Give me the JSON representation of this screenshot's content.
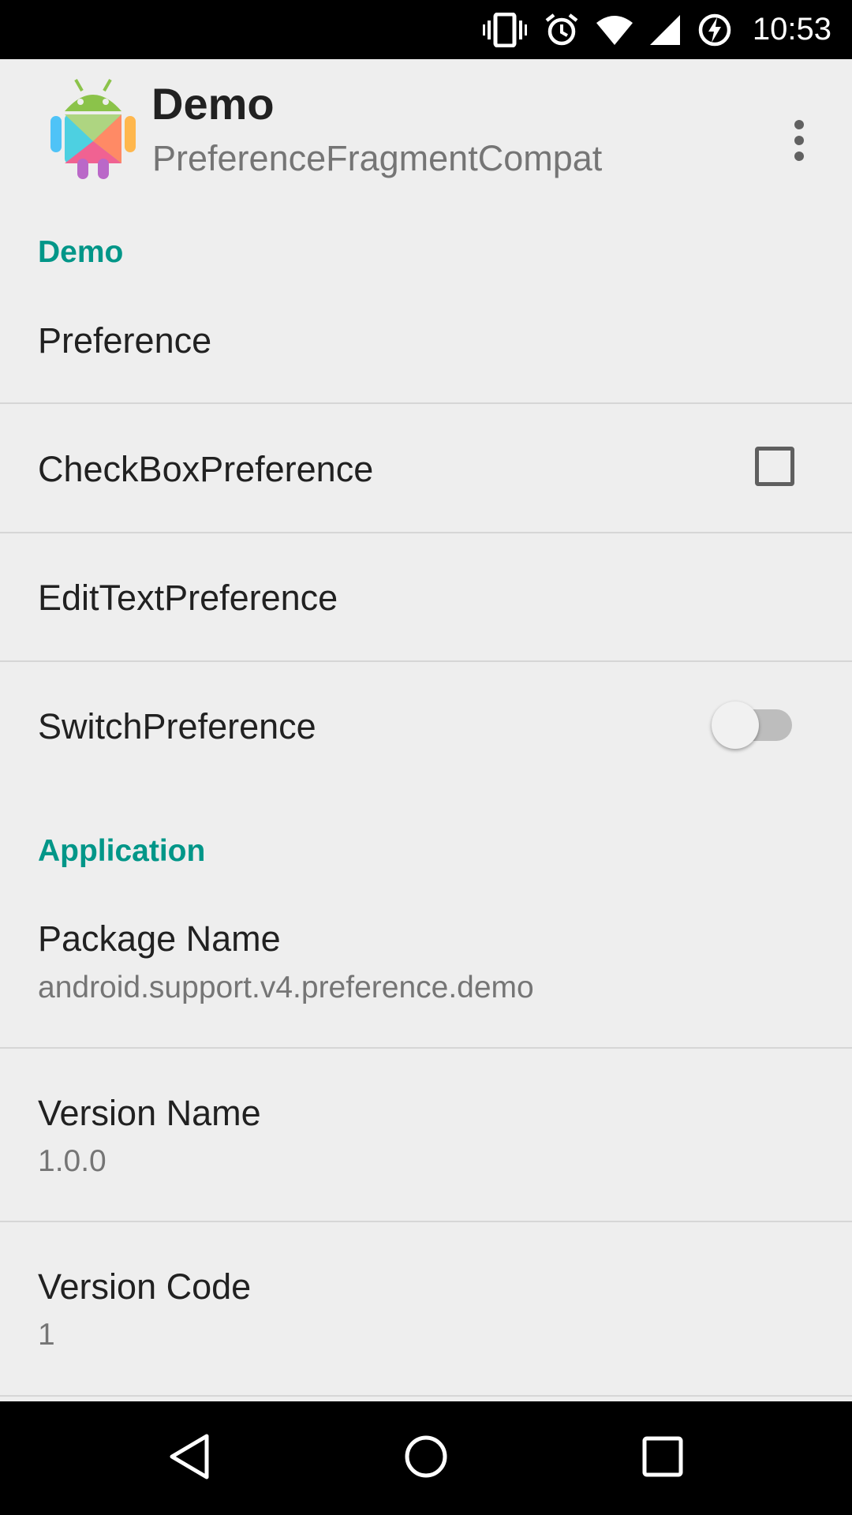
{
  "status_bar": {
    "time": "10:53",
    "icons": [
      "vibrate-icon",
      "alarm-icon",
      "wifi-icon",
      "cell-signal-icon",
      "battery-charging-icon"
    ]
  },
  "app_bar": {
    "title": "Demo",
    "subtitle": "PreferenceFragmentCompat",
    "logo_icon": "android-logo-icon",
    "overflow_icon": "more-vert-icon"
  },
  "categories": {
    "demo": "Demo",
    "application": "Application"
  },
  "preferences": {
    "preference": {
      "title": "Preference"
    },
    "checkbox": {
      "title": "CheckBoxPreference",
      "checked": false
    },
    "edittext": {
      "title": "EditTextPreference"
    },
    "switch": {
      "title": "SwitchPreference",
      "on": false
    },
    "package_name": {
      "title": "Package Name",
      "summary": "android.support.v4.preference.demo"
    },
    "version_name": {
      "title": "Version Name",
      "summary": "1.0.0"
    },
    "version_code": {
      "title": "Version Code",
      "summary": "1"
    }
  },
  "nav_bar": {
    "icons": [
      "back-icon",
      "home-icon",
      "recents-icon"
    ]
  },
  "colors": {
    "accent": "#009688",
    "background": "#EEEEEE",
    "bars": "#000000"
  }
}
